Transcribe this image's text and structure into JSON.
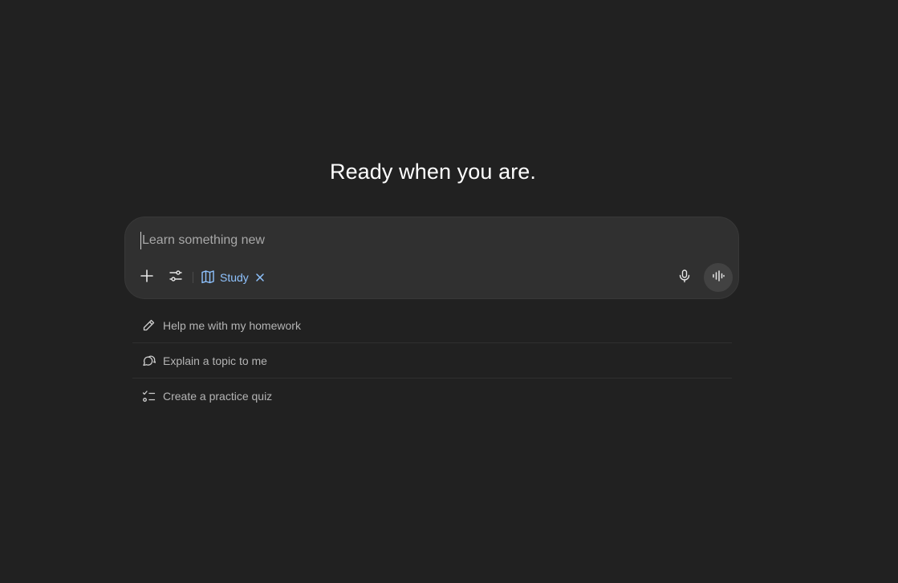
{
  "headline": "Ready when you are.",
  "composer": {
    "placeholder": "Learn something new",
    "add_icon": "plus-icon",
    "tools_icon": "sliders-icon",
    "mode": {
      "label": "Study",
      "icon": "book-icon",
      "color": "#8fc3ff"
    },
    "mic_icon": "microphone-icon",
    "voice_icon": "voice-waveform-icon"
  },
  "suggestions": [
    {
      "label": "Help me with my homework",
      "icon": "pencil-icon"
    },
    {
      "label": "Explain a topic to me",
      "icon": "chat-bubbles-icon"
    },
    {
      "label": "Create a practice quiz",
      "icon": "checklist-icon"
    }
  ],
  "colors": {
    "background": "#212121",
    "composer": "#303030",
    "accent": "#8fc3ff"
  }
}
